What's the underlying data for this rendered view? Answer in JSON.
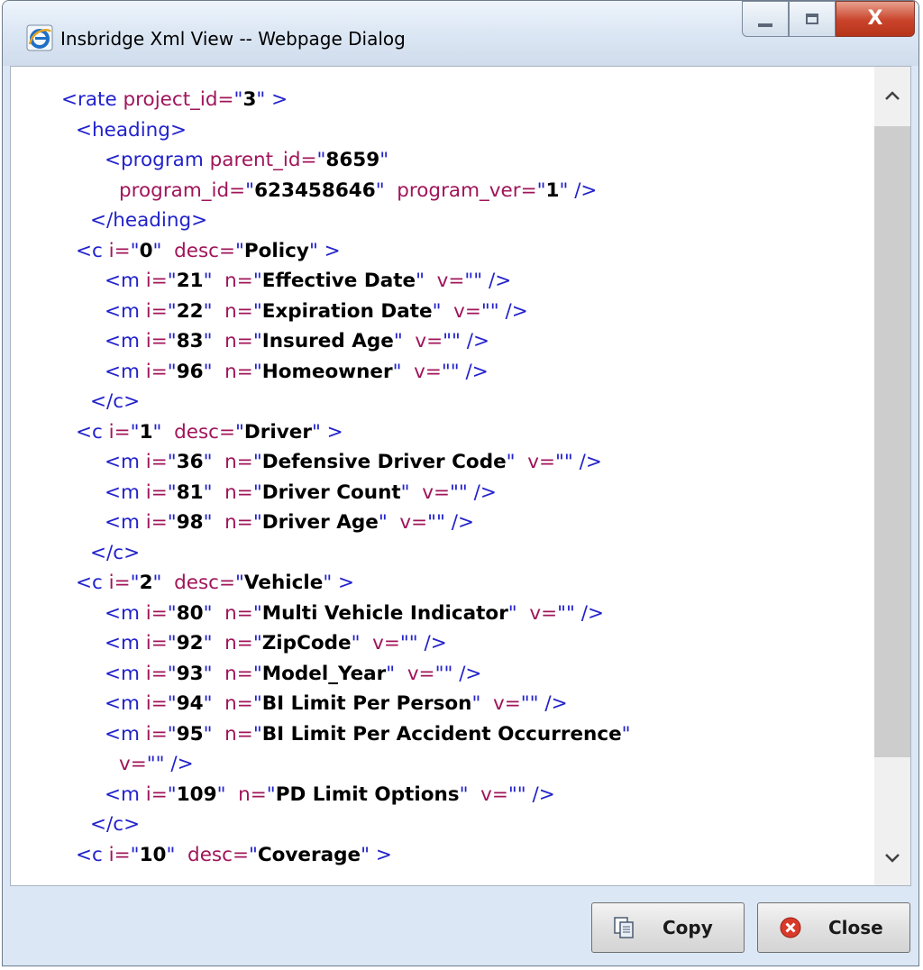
{
  "window": {
    "title": "Insbridge Xml View -- Webpage Dialog",
    "close_glyph": "X"
  },
  "icons": {
    "title_icon": "ie-icon",
    "copy_icon": "copy-icon",
    "close_icon": "close-circle-icon"
  },
  "colors": {
    "tag": "#2222cc",
    "attribute": "#a0155a",
    "value": "#000000",
    "close_button": "#c9432a"
  },
  "xml_lines": [
    {
      "indent": 0,
      "tokens": [
        {
          "k": "t",
          "s": "<rate "
        },
        {
          "k": "a",
          "s": "project_id="
        },
        {
          "k": "t",
          "s": "\""
        },
        {
          "k": "v",
          "s": "3"
        },
        {
          "k": "t",
          "s": "\" >"
        }
      ]
    },
    {
      "indent": 1,
      "tokens": [
        {
          "k": "t",
          "s": "<heading>"
        }
      ]
    },
    {
      "indent": 3,
      "tokens": [
        {
          "k": "t",
          "s": "<program "
        },
        {
          "k": "a",
          "s": "parent_id="
        },
        {
          "k": "t",
          "s": "\""
        },
        {
          "k": "v",
          "s": "8659"
        },
        {
          "k": "t",
          "s": "\""
        }
      ]
    },
    {
      "indent": 4,
      "tokens": [
        {
          "k": "a",
          "s": "program_id="
        },
        {
          "k": "t",
          "s": "\""
        },
        {
          "k": "v",
          "s": "623458646"
        },
        {
          "k": "t",
          "s": "\"  "
        },
        {
          "k": "a",
          "s": "program_ver="
        },
        {
          "k": "t",
          "s": "\""
        },
        {
          "k": "v",
          "s": "1"
        },
        {
          "k": "t",
          "s": "\" />"
        }
      ]
    },
    {
      "indent": 2,
      "tokens": [
        {
          "k": "t",
          "s": "</heading>"
        }
      ]
    },
    {
      "indent": 1,
      "tokens": [
        {
          "k": "t",
          "s": "<c "
        },
        {
          "k": "a",
          "s": "i="
        },
        {
          "k": "t",
          "s": "\""
        },
        {
          "k": "v",
          "s": "0"
        },
        {
          "k": "t",
          "s": "\"  "
        },
        {
          "k": "a",
          "s": "desc="
        },
        {
          "k": "t",
          "s": "\""
        },
        {
          "k": "v",
          "s": "Policy"
        },
        {
          "k": "t",
          "s": "\" >"
        }
      ]
    },
    {
      "indent": 3,
      "tokens": [
        {
          "k": "t",
          "s": "<m "
        },
        {
          "k": "a",
          "s": "i="
        },
        {
          "k": "t",
          "s": "\""
        },
        {
          "k": "v",
          "s": "21"
        },
        {
          "k": "t",
          "s": "\"  "
        },
        {
          "k": "a",
          "s": "n="
        },
        {
          "k": "t",
          "s": "\""
        },
        {
          "k": "v",
          "s": "Effective Date"
        },
        {
          "k": "t",
          "s": "\"  "
        },
        {
          "k": "a",
          "s": "v="
        },
        {
          "k": "t",
          "s": "\"\" />"
        }
      ]
    },
    {
      "indent": 3,
      "tokens": [
        {
          "k": "t",
          "s": "<m "
        },
        {
          "k": "a",
          "s": "i="
        },
        {
          "k": "t",
          "s": "\""
        },
        {
          "k": "v",
          "s": "22"
        },
        {
          "k": "t",
          "s": "\"  "
        },
        {
          "k": "a",
          "s": "n="
        },
        {
          "k": "t",
          "s": "\""
        },
        {
          "k": "v",
          "s": "Expiration Date"
        },
        {
          "k": "t",
          "s": "\"  "
        },
        {
          "k": "a",
          "s": "v="
        },
        {
          "k": "t",
          "s": "\"\" />"
        }
      ]
    },
    {
      "indent": 3,
      "tokens": [
        {
          "k": "t",
          "s": "<m "
        },
        {
          "k": "a",
          "s": "i="
        },
        {
          "k": "t",
          "s": "\""
        },
        {
          "k": "v",
          "s": "83"
        },
        {
          "k": "t",
          "s": "\"  "
        },
        {
          "k": "a",
          "s": "n="
        },
        {
          "k": "t",
          "s": "\""
        },
        {
          "k": "v",
          "s": "Insured Age"
        },
        {
          "k": "t",
          "s": "\"  "
        },
        {
          "k": "a",
          "s": "v="
        },
        {
          "k": "t",
          "s": "\"\" />"
        }
      ]
    },
    {
      "indent": 3,
      "tokens": [
        {
          "k": "t",
          "s": "<m "
        },
        {
          "k": "a",
          "s": "i="
        },
        {
          "k": "t",
          "s": "\""
        },
        {
          "k": "v",
          "s": "96"
        },
        {
          "k": "t",
          "s": "\"  "
        },
        {
          "k": "a",
          "s": "n="
        },
        {
          "k": "t",
          "s": "\""
        },
        {
          "k": "v",
          "s": "Homeowner"
        },
        {
          "k": "t",
          "s": "\"  "
        },
        {
          "k": "a",
          "s": "v="
        },
        {
          "k": "t",
          "s": "\"\" />"
        }
      ]
    },
    {
      "indent": 2,
      "tokens": [
        {
          "k": "t",
          "s": "</c>"
        }
      ]
    },
    {
      "indent": 1,
      "tokens": [
        {
          "k": "t",
          "s": "<c "
        },
        {
          "k": "a",
          "s": "i="
        },
        {
          "k": "t",
          "s": "\""
        },
        {
          "k": "v",
          "s": "1"
        },
        {
          "k": "t",
          "s": "\"  "
        },
        {
          "k": "a",
          "s": "desc="
        },
        {
          "k": "t",
          "s": "\""
        },
        {
          "k": "v",
          "s": "Driver"
        },
        {
          "k": "t",
          "s": "\" >"
        }
      ]
    },
    {
      "indent": 3,
      "tokens": [
        {
          "k": "t",
          "s": "<m "
        },
        {
          "k": "a",
          "s": "i="
        },
        {
          "k": "t",
          "s": "\""
        },
        {
          "k": "v",
          "s": "36"
        },
        {
          "k": "t",
          "s": "\"  "
        },
        {
          "k": "a",
          "s": "n="
        },
        {
          "k": "t",
          "s": "\""
        },
        {
          "k": "v",
          "s": "Defensive Driver Code"
        },
        {
          "k": "t",
          "s": "\"  "
        },
        {
          "k": "a",
          "s": "v="
        },
        {
          "k": "t",
          "s": "\"\" />"
        }
      ]
    },
    {
      "indent": 3,
      "tokens": [
        {
          "k": "t",
          "s": "<m "
        },
        {
          "k": "a",
          "s": "i="
        },
        {
          "k": "t",
          "s": "\""
        },
        {
          "k": "v",
          "s": "81"
        },
        {
          "k": "t",
          "s": "\"  "
        },
        {
          "k": "a",
          "s": "n="
        },
        {
          "k": "t",
          "s": "\""
        },
        {
          "k": "v",
          "s": "Driver Count"
        },
        {
          "k": "t",
          "s": "\"  "
        },
        {
          "k": "a",
          "s": "v="
        },
        {
          "k": "t",
          "s": "\"\" />"
        }
      ]
    },
    {
      "indent": 3,
      "tokens": [
        {
          "k": "t",
          "s": "<m "
        },
        {
          "k": "a",
          "s": "i="
        },
        {
          "k": "t",
          "s": "\""
        },
        {
          "k": "v",
          "s": "98"
        },
        {
          "k": "t",
          "s": "\"  "
        },
        {
          "k": "a",
          "s": "n="
        },
        {
          "k": "t",
          "s": "\""
        },
        {
          "k": "v",
          "s": "Driver Age"
        },
        {
          "k": "t",
          "s": "\"  "
        },
        {
          "k": "a",
          "s": "v="
        },
        {
          "k": "t",
          "s": "\"\" />"
        }
      ]
    },
    {
      "indent": 2,
      "tokens": [
        {
          "k": "t",
          "s": "</c>"
        }
      ]
    },
    {
      "indent": 1,
      "tokens": [
        {
          "k": "t",
          "s": "<c "
        },
        {
          "k": "a",
          "s": "i="
        },
        {
          "k": "t",
          "s": "\""
        },
        {
          "k": "v",
          "s": "2"
        },
        {
          "k": "t",
          "s": "\"  "
        },
        {
          "k": "a",
          "s": "desc="
        },
        {
          "k": "t",
          "s": "\""
        },
        {
          "k": "v",
          "s": "Vehicle"
        },
        {
          "k": "t",
          "s": "\" >"
        }
      ]
    },
    {
      "indent": 3,
      "tokens": [
        {
          "k": "t",
          "s": "<m "
        },
        {
          "k": "a",
          "s": "i="
        },
        {
          "k": "t",
          "s": "\""
        },
        {
          "k": "v",
          "s": "80"
        },
        {
          "k": "t",
          "s": "\"  "
        },
        {
          "k": "a",
          "s": "n="
        },
        {
          "k": "t",
          "s": "\""
        },
        {
          "k": "v",
          "s": "Multi Vehicle Indicator"
        },
        {
          "k": "t",
          "s": "\"  "
        },
        {
          "k": "a",
          "s": "v="
        },
        {
          "k": "t",
          "s": "\"\" />"
        }
      ]
    },
    {
      "indent": 3,
      "tokens": [
        {
          "k": "t",
          "s": "<m "
        },
        {
          "k": "a",
          "s": "i="
        },
        {
          "k": "t",
          "s": "\""
        },
        {
          "k": "v",
          "s": "92"
        },
        {
          "k": "t",
          "s": "\"  "
        },
        {
          "k": "a",
          "s": "n="
        },
        {
          "k": "t",
          "s": "\""
        },
        {
          "k": "v",
          "s": "ZipCode"
        },
        {
          "k": "t",
          "s": "\"  "
        },
        {
          "k": "a",
          "s": "v="
        },
        {
          "k": "t",
          "s": "\"\" />"
        }
      ]
    },
    {
      "indent": 3,
      "tokens": [
        {
          "k": "t",
          "s": "<m "
        },
        {
          "k": "a",
          "s": "i="
        },
        {
          "k": "t",
          "s": "\""
        },
        {
          "k": "v",
          "s": "93"
        },
        {
          "k": "t",
          "s": "\"  "
        },
        {
          "k": "a",
          "s": "n="
        },
        {
          "k": "t",
          "s": "\""
        },
        {
          "k": "v",
          "s": "Model_Year"
        },
        {
          "k": "t",
          "s": "\"  "
        },
        {
          "k": "a",
          "s": "v="
        },
        {
          "k": "t",
          "s": "\"\" />"
        }
      ]
    },
    {
      "indent": 3,
      "tokens": [
        {
          "k": "t",
          "s": "<m "
        },
        {
          "k": "a",
          "s": "i="
        },
        {
          "k": "t",
          "s": "\""
        },
        {
          "k": "v",
          "s": "94"
        },
        {
          "k": "t",
          "s": "\"  "
        },
        {
          "k": "a",
          "s": "n="
        },
        {
          "k": "t",
          "s": "\""
        },
        {
          "k": "v",
          "s": "BI Limit Per Person"
        },
        {
          "k": "t",
          "s": "\"  "
        },
        {
          "k": "a",
          "s": "v="
        },
        {
          "k": "t",
          "s": "\"\" />"
        }
      ]
    },
    {
      "indent": 3,
      "tokens": [
        {
          "k": "t",
          "s": "<m "
        },
        {
          "k": "a",
          "s": "i="
        },
        {
          "k": "t",
          "s": "\""
        },
        {
          "k": "v",
          "s": "95"
        },
        {
          "k": "t",
          "s": "\"  "
        },
        {
          "k": "a",
          "s": "n="
        },
        {
          "k": "t",
          "s": "\""
        },
        {
          "k": "v",
          "s": "BI Limit Per Accident Occurrence"
        },
        {
          "k": "t",
          "s": "\""
        }
      ]
    },
    {
      "indent": 4,
      "tokens": [
        {
          "k": "a",
          "s": "v="
        },
        {
          "k": "t",
          "s": "\"\" />"
        }
      ]
    },
    {
      "indent": 3,
      "tokens": [
        {
          "k": "t",
          "s": "<m "
        },
        {
          "k": "a",
          "s": "i="
        },
        {
          "k": "t",
          "s": "\""
        },
        {
          "k": "v",
          "s": "109"
        },
        {
          "k": "t",
          "s": "\"  "
        },
        {
          "k": "a",
          "s": "n="
        },
        {
          "k": "t",
          "s": "\""
        },
        {
          "k": "v",
          "s": "PD Limit Options"
        },
        {
          "k": "t",
          "s": "\"  "
        },
        {
          "k": "a",
          "s": "v="
        },
        {
          "k": "t",
          "s": "\"\" />"
        }
      ]
    },
    {
      "indent": 2,
      "tokens": [
        {
          "k": "t",
          "s": "</c>"
        }
      ]
    },
    {
      "indent": 1,
      "tokens": [
        {
          "k": "t",
          "s": "<c "
        },
        {
          "k": "a",
          "s": "i="
        },
        {
          "k": "t",
          "s": "\""
        },
        {
          "k": "v",
          "s": "10"
        },
        {
          "k": "t",
          "s": "\"  "
        },
        {
          "k": "a",
          "s": "desc="
        },
        {
          "k": "t",
          "s": "\""
        },
        {
          "k": "v",
          "s": "Coverage"
        },
        {
          "k": "t",
          "s": "\" >"
        }
      ]
    }
  ],
  "buttons": {
    "copy_label": "Copy",
    "close_label": "Close"
  }
}
